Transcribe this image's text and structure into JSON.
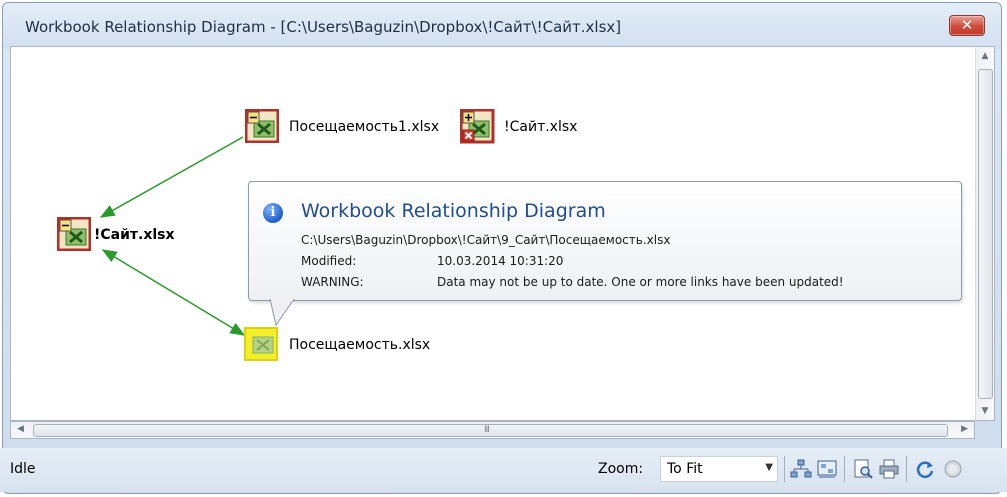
{
  "window": {
    "title": "Workbook Relationship Diagram - [C:\\Users\\Baguzin\\Dropbox\\!Сайт\\!Сайт.xlsx]",
    "close_label": "✕"
  },
  "diagram": {
    "nodes": [
      {
        "id": "root",
        "label": "!Сайт.xlsx",
        "icon": "excel-workbook-collapse-icon"
      },
      {
        "id": "pos1",
        "label": "Посещаемость1.xlsx",
        "icon": "excel-workbook-collapse-icon"
      },
      {
        "id": "site2",
        "label": "!Сайт.xlsx",
        "icon": "excel-workbook-expand-missing-icon"
      },
      {
        "id": "pos",
        "label": "Посещаемость.xlsx",
        "icon": "excel-workbook-highlighted-icon"
      }
    ],
    "link_color": "#2a9b2a"
  },
  "tooltip": {
    "title": "Workbook Relationship Diagram",
    "path": "C:\\Users\\Baguzin\\Dropbox\\!Сайт\\9_Сайт\\Посещаемость.xlsx",
    "modified_label": "Modified:",
    "modified_value": "10.03.2014 10:31:20",
    "warning_label": "WARNING:",
    "warning_value": "Data may not be up to date. One or more links have been updated!"
  },
  "scroll": {
    "grip": "III"
  },
  "statusbar": {
    "status": "Idle",
    "zoom_label": "Zoom:",
    "zoom_value": "To Fit"
  },
  "toolbar": {
    "icons": [
      "layout-tree-icon",
      "layout-diagram-icon",
      "print-preview-icon",
      "print-icon",
      "refresh-icon",
      "stop-icon"
    ]
  }
}
